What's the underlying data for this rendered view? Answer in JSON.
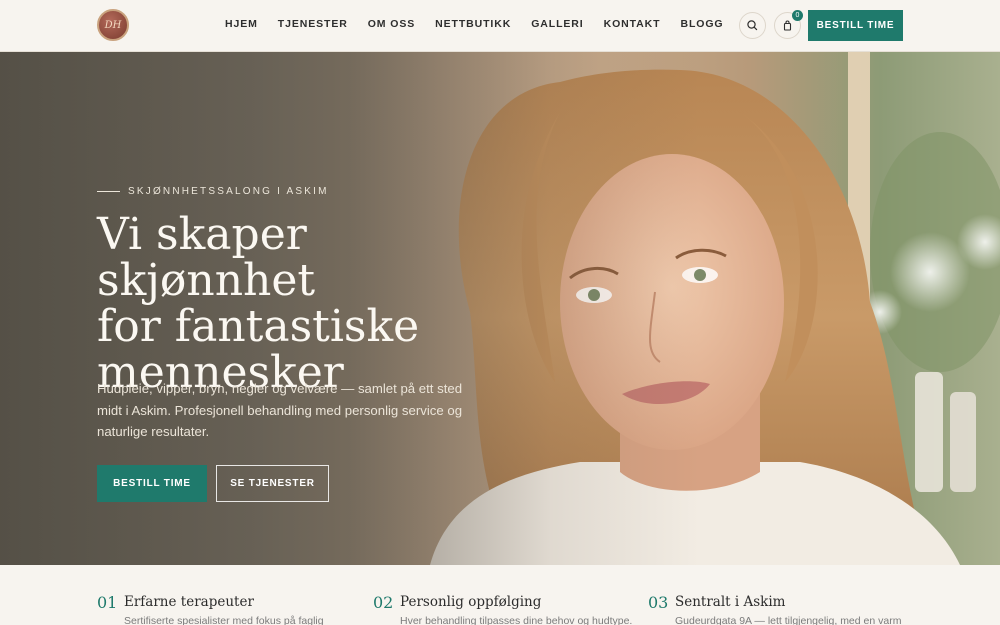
{
  "header": {
    "logo_text": "DH",
    "nav": [
      "HJEM",
      "TJENESTER",
      "OM OSS",
      "NETTBUTIKK",
      "GALLERI",
      "KONTAKT",
      "BLOGG"
    ],
    "cart_count": "0",
    "cta_label": "BESTILL TIME"
  },
  "hero": {
    "eyebrow": "SKJØNNHETSSALONG I ASKIM",
    "title_lines": [
      "Vi skaper skjønnhet",
      "for fantastiske",
      "mennesker"
    ],
    "subtitle": "Hudpleie, vipper, bryn, negler og velvære — samlet på ett sted midt i Askim. Profesjonell behandling med personlig service og naturlige resultater.",
    "primary_button": "BESTILL TIME",
    "secondary_button": "SE TJENESTER"
  },
  "features": [
    {
      "num": "01",
      "title": "Erfarne terapeuter",
      "desc": "Sertifiserte spesialister med fokus på faglig"
    },
    {
      "num": "02",
      "title": "Personlig oppfølging",
      "desc": "Hver behandling tilpasses dine behov og hudtype."
    },
    {
      "num": "03",
      "title": "Sentralt i Askim",
      "desc": "Gudeurdgata 9A — lett tilgjengelig, med en varm"
    }
  ],
  "colors": {
    "accent": "#1f7a6c",
    "background": "#f7f4ef"
  }
}
